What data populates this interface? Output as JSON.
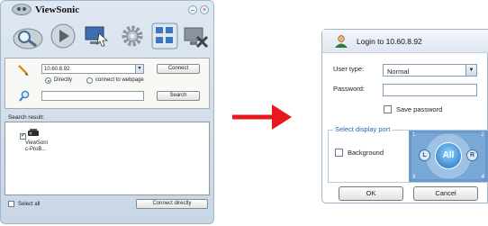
{
  "left_window": {
    "title": "ViewSonic",
    "toolbar_icons": [
      "search-icon",
      "play-icon",
      "screen-select-icon",
      "settings-gear-icon",
      "multi-display-icon",
      "disconnect-display-icon"
    ],
    "ip_value": "10.60.8.92",
    "connect_label": "Connect",
    "radio_directly": "Directly",
    "radio_webpage": "connect to webpage",
    "search_value": "",
    "search_label": "Search",
    "results_label": "Search result:",
    "device_name_line1": "ViewSoni",
    "device_name_line2": "c-ProB...",
    "select_all": "Select all",
    "connect_directly": "Connect directly",
    "minimize_glyph": "–",
    "close_glyph": "×"
  },
  "right_window": {
    "title": "Login to 10.60.8.92",
    "user_type_label": "User type:",
    "user_type_value": "Normal",
    "password_label": "Password:",
    "password_value": "",
    "save_password": "Save password",
    "display_port_label": "Select display port",
    "background_label": "Background",
    "port_all": "All",
    "port_1": "1",
    "port_2": "2",
    "port_3": "3",
    "port_4": "4",
    "port_l": "L",
    "port_r": "R",
    "ok_label": "OK",
    "cancel_label": "Cancel"
  },
  "colors": {
    "arrow": "#e8191d",
    "accent": "#2a63b7",
    "pad": "#5c8fc4"
  }
}
